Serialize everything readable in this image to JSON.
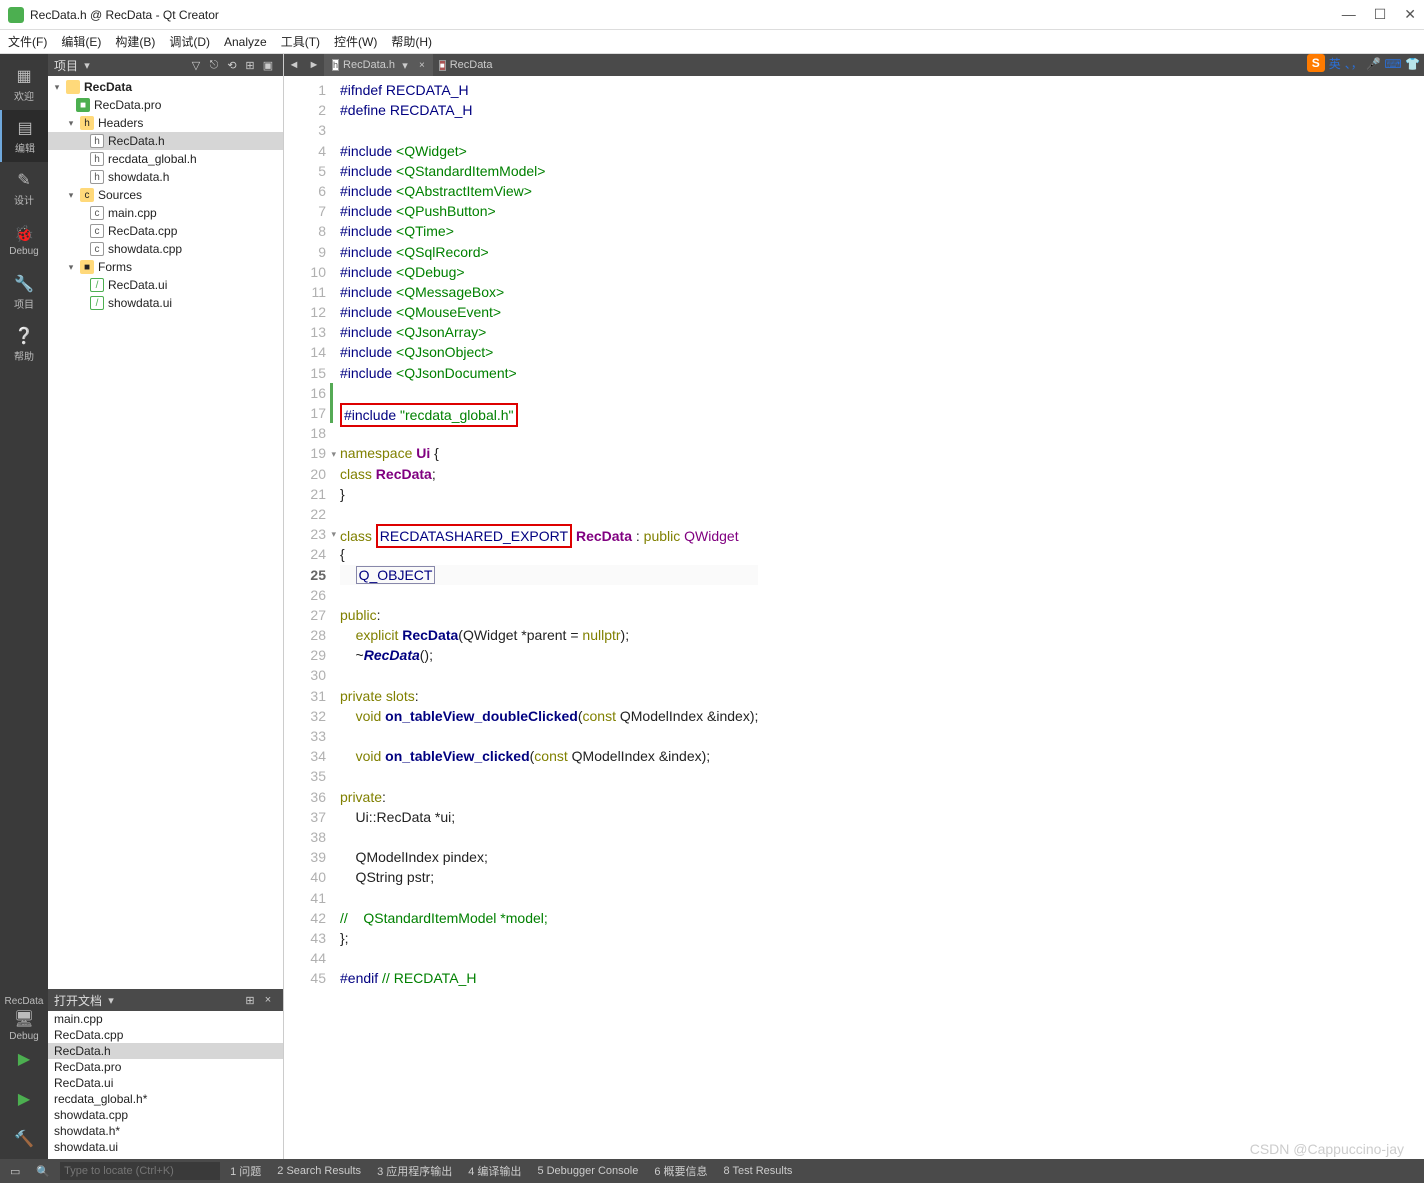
{
  "window": {
    "title": "RecData.h @ RecData - Qt Creator"
  },
  "winbuttons": {
    "min": "—",
    "max": "☐",
    "close": "✕"
  },
  "menu": [
    "文件(F)",
    "编辑(E)",
    "构建(B)",
    "调试(D)",
    "Analyze",
    "工具(T)",
    "控件(W)",
    "帮助(H)"
  ],
  "rail": {
    "welcome": "欢迎",
    "edit": "编辑",
    "design": "设计",
    "debug": "Debug",
    "project": "项目",
    "help": "帮助",
    "target": "RecData",
    "targetmode": "Debug"
  },
  "projectsPanel": {
    "title": "项目"
  },
  "tree": {
    "root": "RecData",
    "pro": "RecData.pro",
    "headers": "Headers",
    "headers_items": [
      "RecData.h",
      "recdata_global.h",
      "showdata.h"
    ],
    "sources": "Sources",
    "sources_items": [
      "main.cpp",
      "RecData.cpp",
      "showdata.cpp"
    ],
    "forms": "Forms",
    "forms_items": [
      "RecData.ui",
      "showdata.ui"
    ]
  },
  "openDocs": {
    "title": "打开文档",
    "items": [
      "main.cpp",
      "RecData.cpp",
      "RecData.h",
      "RecData.pro",
      "RecData.ui",
      "recdata_global.h*",
      "showdata.cpp",
      "showdata.h*",
      "showdata.ui"
    ],
    "selected": "RecData.h"
  },
  "tabs": {
    "active": "RecData.h",
    "crumb": "RecData"
  },
  "code": {
    "lines": [
      {
        "n": 1,
        "seg": [
          [
            "pp",
            "#ifndef"
          ],
          [
            "",
            ""
          ],
          [
            "macro",
            " RECDATA_H"
          ]
        ]
      },
      {
        "n": 2,
        "seg": [
          [
            "pp",
            "#define"
          ],
          [
            "macro",
            " RECDATA_H"
          ]
        ]
      },
      {
        "n": 3,
        "seg": [
          [
            "",
            ""
          ]
        ]
      },
      {
        "n": 4,
        "seg": [
          [
            "pp",
            "#include"
          ],
          [
            "",
            " "
          ],
          [
            "inc",
            "<QWidget>"
          ]
        ]
      },
      {
        "n": 5,
        "seg": [
          [
            "pp",
            "#include"
          ],
          [
            "",
            " "
          ],
          [
            "inc",
            "<QStandardItemModel>"
          ]
        ]
      },
      {
        "n": 6,
        "seg": [
          [
            "pp",
            "#include"
          ],
          [
            "",
            " "
          ],
          [
            "inc",
            "<QAbstractItemView>"
          ]
        ]
      },
      {
        "n": 7,
        "seg": [
          [
            "pp",
            "#include"
          ],
          [
            "",
            " "
          ],
          [
            "inc",
            "<QPushButton>"
          ]
        ]
      },
      {
        "n": 8,
        "seg": [
          [
            "pp",
            "#include"
          ],
          [
            "",
            " "
          ],
          [
            "inc",
            "<QTime>"
          ]
        ]
      },
      {
        "n": 9,
        "seg": [
          [
            "pp",
            "#include"
          ],
          [
            "",
            " "
          ],
          [
            "inc",
            "<QSqlRecord>"
          ]
        ]
      },
      {
        "n": 10,
        "seg": [
          [
            "pp",
            "#include"
          ],
          [
            "",
            " "
          ],
          [
            "inc",
            "<QDebug>"
          ]
        ]
      },
      {
        "n": 11,
        "seg": [
          [
            "pp",
            "#include"
          ],
          [
            "",
            " "
          ],
          [
            "inc",
            "<QMessageBox>"
          ]
        ]
      },
      {
        "n": 12,
        "seg": [
          [
            "pp",
            "#include"
          ],
          [
            "",
            " "
          ],
          [
            "inc",
            "<QMouseEvent>"
          ]
        ]
      },
      {
        "n": 13,
        "seg": [
          [
            "pp",
            "#include"
          ],
          [
            "",
            " "
          ],
          [
            "inc",
            "<QJsonArray>"
          ]
        ]
      },
      {
        "n": 14,
        "seg": [
          [
            "pp",
            "#include"
          ],
          [
            "",
            " "
          ],
          [
            "inc",
            "<QJsonObject>"
          ]
        ]
      },
      {
        "n": 15,
        "seg": [
          [
            "pp",
            "#include"
          ],
          [
            "",
            " "
          ],
          [
            "inc",
            "<QJsonDocument>"
          ]
        ]
      },
      {
        "n": 16,
        "seg": [
          [
            "",
            ""
          ]
        ],
        "green": true
      },
      {
        "n": 17,
        "seg": [
          [
            "pp",
            "#include"
          ],
          [
            "",
            " "
          ],
          [
            "inc",
            "\"recdata_global.h\""
          ]
        ],
        "green": true,
        "redbox": true
      },
      {
        "n": 18,
        "seg": [
          [
            "",
            ""
          ]
        ]
      },
      {
        "n": 19,
        "seg": [
          [
            "kw",
            "namespace"
          ],
          [
            "",
            " "
          ],
          [
            "cls",
            "Ui"
          ],
          [
            "",
            " {"
          ]
        ],
        "fold": true
      },
      {
        "n": 20,
        "seg": [
          [
            "kw",
            "class"
          ],
          [
            "",
            " "
          ],
          [
            "cls",
            "RecData"
          ],
          [
            "",
            ";"
          ]
        ]
      },
      {
        "n": 21,
        "seg": [
          [
            "",
            "}"
          ]
        ]
      },
      {
        "n": 22,
        "seg": [
          [
            "",
            ""
          ]
        ]
      },
      {
        "n": 23,
        "seg": [
          [
            "kw",
            "class"
          ],
          [
            "",
            " "
          ],
          [
            "redmacro",
            "RECDATASHARED_EXPORT"
          ],
          [
            "",
            " "
          ],
          [
            "cls",
            "RecData"
          ],
          [
            "",
            " : "
          ],
          [
            "kw",
            "public"
          ],
          [
            "",
            " "
          ],
          [
            "type",
            "QWidget"
          ]
        ],
        "fold": true
      },
      {
        "n": 24,
        "seg": [
          [
            "",
            "{"
          ]
        ]
      },
      {
        "n": 25,
        "seg": [
          [
            "",
            "    "
          ],
          [
            "bluemacro",
            "Q_OBJECT"
          ]
        ],
        "cur": true
      },
      {
        "n": 26,
        "seg": [
          [
            "",
            ""
          ]
        ]
      },
      {
        "n": 27,
        "seg": [
          [
            "kw",
            "public"
          ],
          [
            "",
            ":"
          ]
        ]
      },
      {
        "n": 28,
        "seg": [
          [
            "",
            "    "
          ],
          [
            "kw",
            "explicit"
          ],
          [
            "",
            " "
          ],
          [
            "fn",
            "RecData"
          ],
          [
            "",
            "(QWidget *parent = "
          ],
          [
            "kw",
            "nullptr"
          ],
          [
            "",
            ");"
          ]
        ]
      },
      {
        "n": 29,
        "seg": [
          [
            "",
            "    ~"
          ],
          [
            "fni",
            "RecData"
          ],
          [
            "",
            "();"
          ]
        ]
      },
      {
        "n": 30,
        "seg": [
          [
            "",
            ""
          ]
        ]
      },
      {
        "n": 31,
        "seg": [
          [
            "kw",
            "private"
          ],
          [
            "",
            " "
          ],
          [
            "kw",
            "slots"
          ],
          [
            "",
            ":"
          ]
        ]
      },
      {
        "n": 32,
        "seg": [
          [
            "",
            "    "
          ],
          [
            "kw",
            "void"
          ],
          [
            "",
            " "
          ],
          [
            "fn",
            "on_tableView_doubleClicked"
          ],
          [
            "",
            "("
          ],
          [
            "kw",
            "const"
          ],
          [
            "",
            " QModelIndex &index);"
          ]
        ]
      },
      {
        "n": 33,
        "seg": [
          [
            "",
            ""
          ]
        ]
      },
      {
        "n": 34,
        "seg": [
          [
            "",
            "    "
          ],
          [
            "kw",
            "void"
          ],
          [
            "",
            " "
          ],
          [
            "fn",
            "on_tableView_clicked"
          ],
          [
            "",
            "("
          ],
          [
            "kw",
            "const"
          ],
          [
            "",
            " QModelIndex &index);"
          ]
        ]
      },
      {
        "n": 35,
        "seg": [
          [
            "",
            ""
          ]
        ]
      },
      {
        "n": 36,
        "seg": [
          [
            "kw",
            "private"
          ],
          [
            "",
            ":"
          ]
        ]
      },
      {
        "n": 37,
        "seg": [
          [
            "",
            "    Ui::RecData *ui;"
          ]
        ]
      },
      {
        "n": 38,
        "seg": [
          [
            "",
            ""
          ]
        ]
      },
      {
        "n": 39,
        "seg": [
          [
            "",
            "    QModelIndex pindex;"
          ]
        ]
      },
      {
        "n": 40,
        "seg": [
          [
            "",
            "    QString pstr;"
          ]
        ]
      },
      {
        "n": 41,
        "seg": [
          [
            "",
            ""
          ]
        ]
      },
      {
        "n": 42,
        "seg": [
          [
            "cmt",
            "//    QStandardItemModel *model;"
          ]
        ]
      },
      {
        "n": 43,
        "seg": [
          [
            "",
            "};"
          ]
        ]
      },
      {
        "n": 44,
        "seg": [
          [
            "",
            ""
          ]
        ]
      },
      {
        "n": 45,
        "seg": [
          [
            "pp",
            "#endif"
          ],
          [
            "",
            " "
          ],
          [
            "cmt",
            "// RECDATA_H"
          ]
        ]
      }
    ]
  },
  "status": {
    "search_ph": "Type to locate (Ctrl+K)",
    "items": [
      "1 问题",
      "2 Search Results",
      "3 应用程序输出",
      "4 编译输出",
      "5 Debugger Console",
      "6 概要信息",
      "8 Test Results"
    ]
  },
  "watermark": "CSDN @Cappuccino-jay",
  "ime": {
    "s": "S",
    "lang": "英",
    "icons": "、， 🎤 ⌨ 👕"
  }
}
